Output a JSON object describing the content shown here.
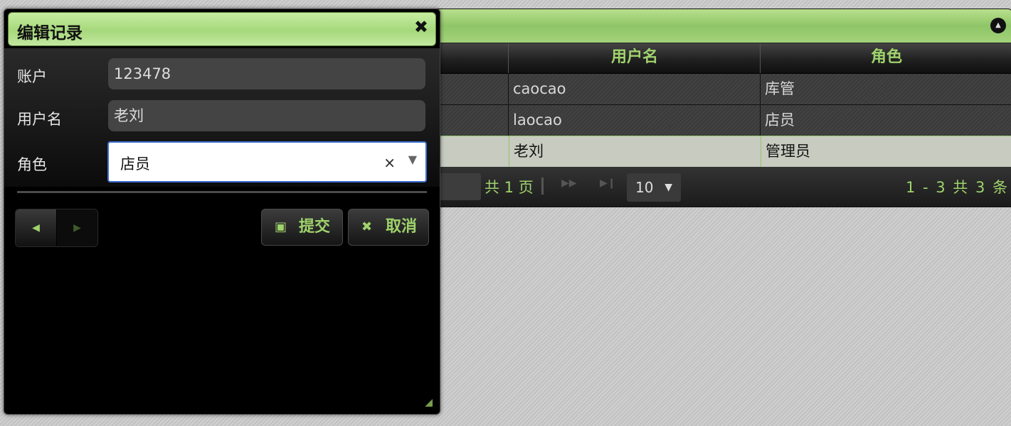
{
  "grid": {
    "collapse_icon": "collapse-up-icon",
    "columns": [
      "用户名",
      "角色"
    ],
    "rows": [
      {
        "username": "caocao",
        "role": "库管",
        "selected": false
      },
      {
        "username": "laocao",
        "role": "店员",
        "selected": false
      },
      {
        "username": "老刘",
        "role": "管理员",
        "selected": true
      }
    ],
    "pager": {
      "total_pages": "共 1 页",
      "rows_per_page": "10",
      "record_info": "1 - 3   共 3 条"
    }
  },
  "dialog": {
    "title": "编辑记录",
    "close_icon": "close-icon",
    "fields": {
      "account": {
        "label": "账户",
        "value": "123478"
      },
      "username": {
        "label": "用户名",
        "value": "老刘"
      },
      "role": {
        "label": "角色",
        "value": "店员"
      }
    },
    "submit_label": "提交",
    "cancel_label": "取消"
  },
  "colors": {
    "accent_green": "#9fd36b",
    "titlebar_green": "#a6d87c",
    "select_border": "#3d6fd1"
  }
}
